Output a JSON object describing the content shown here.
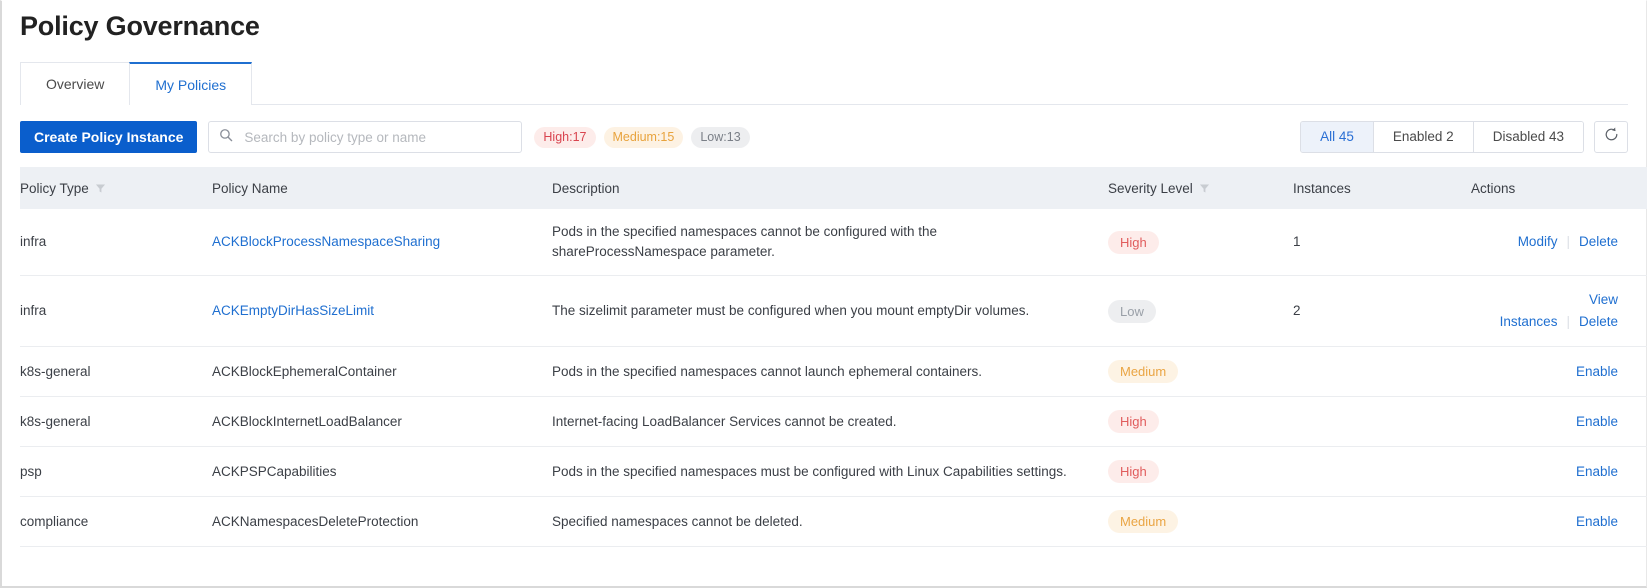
{
  "header": {
    "title": "Policy Governance"
  },
  "tabs": [
    {
      "label": "Overview",
      "active": false
    },
    {
      "label": "My Policies",
      "active": true
    }
  ],
  "toolbar": {
    "create_button": "Create Policy Instance",
    "search": {
      "placeholder": "Search by policy type or name",
      "value": ""
    },
    "severity_chips": [
      {
        "label": "High:17",
        "level": "high"
      },
      {
        "label": "Medium:15",
        "level": "medium"
      },
      {
        "label": "Low:13",
        "level": "low"
      }
    ],
    "status_filters": [
      {
        "label": "All 45",
        "active": true
      },
      {
        "label": "Enabled 2",
        "active": false
      },
      {
        "label": "Disabled 43",
        "active": false
      }
    ],
    "refresh_icon": "refresh-icon"
  },
  "table": {
    "columns": [
      {
        "label": "Policy Type",
        "filter": true
      },
      {
        "label": "Policy Name",
        "filter": false
      },
      {
        "label": "Description",
        "filter": false
      },
      {
        "label": "Severity Level",
        "filter": true
      },
      {
        "label": "Instances",
        "filter": false
      },
      {
        "label": "Actions",
        "filter": false
      }
    ],
    "rows": [
      {
        "policy_type": "infra",
        "policy_name": "ACKBlockProcessNamespaceSharing",
        "name_is_link": true,
        "description": "Pods in the specified namespaces cannot be configured with the shareProcessNamespace parameter.",
        "severity": "High",
        "instances": "1",
        "actions": [
          "Modify",
          "Delete"
        ]
      },
      {
        "policy_type": "infra",
        "policy_name": "ACKEmptyDirHasSizeLimit",
        "name_is_link": true,
        "description": "The sizelimit parameter must be configured when you mount emptyDir volumes.",
        "severity": "Low",
        "instances": "2",
        "actions": [
          "View Instances",
          "Delete"
        ]
      },
      {
        "policy_type": "k8s-general",
        "policy_name": "ACKBlockEphemeralContainer",
        "name_is_link": false,
        "description": "Pods in the specified namespaces cannot launch ephemeral containers.",
        "severity": "Medium",
        "instances": "",
        "actions": [
          "Enable"
        ]
      },
      {
        "policy_type": "k8s-general",
        "policy_name": "ACKBlockInternetLoadBalancer",
        "name_is_link": false,
        "description": "Internet-facing LoadBalancer Services cannot be created.",
        "severity": "High",
        "instances": "",
        "actions": [
          "Enable"
        ]
      },
      {
        "policy_type": "psp",
        "policy_name": "ACKPSPCapabilities",
        "name_is_link": false,
        "description": "Pods in the specified namespaces must be configured with Linux Capabilities settings.",
        "severity": "High",
        "instances": "",
        "actions": [
          "Enable"
        ]
      },
      {
        "policy_type": "compliance",
        "policy_name": "ACKNamespacesDeleteProtection",
        "name_is_link": false,
        "description": "Specified namespaces cannot be deleted.",
        "severity": "Medium",
        "instances": "",
        "actions": [
          "Enable"
        ]
      }
    ]
  },
  "colors": {
    "primary": "#0a5ecc",
    "link": "#1f6fd0",
    "high": "#e05c5c",
    "medium": "#eaa544",
    "low": "#9aa0a8",
    "header_bg": "#edf0f4"
  }
}
